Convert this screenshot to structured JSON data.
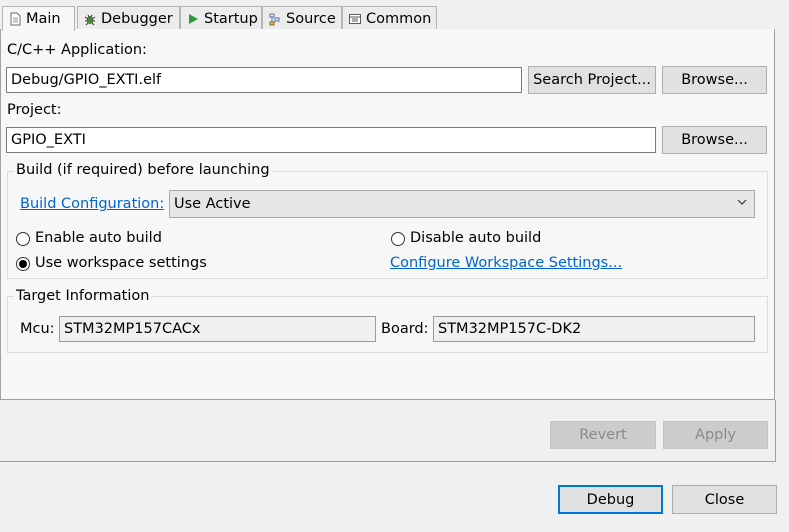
{
  "tabs": [
    {
      "label": "Main",
      "icon": "document-icon"
    },
    {
      "label": "Debugger",
      "icon": "bug-icon"
    },
    {
      "label": "Startup",
      "icon": "play-icon"
    },
    {
      "label": "Source",
      "icon": "source-icon"
    },
    {
      "label": "Common",
      "icon": "window-icon"
    }
  ],
  "application": {
    "label": "C/C++ Application:",
    "value": "Debug/GPIO_EXTI.elf",
    "search_button": "Search Project...",
    "browse_button": "Browse..."
  },
  "project": {
    "label": "Project:",
    "value": "GPIO_EXTI",
    "browse_button": "Browse..."
  },
  "build": {
    "group_title": "Build (if required) before launching",
    "config_link": "Build Configuration:",
    "config_value": "Use Active",
    "enable_auto": "Enable auto build",
    "disable_auto": "Disable auto build",
    "use_workspace": "Use workspace settings",
    "workspace_link": "Configure Workspace Settings..."
  },
  "target": {
    "group_title": "Target Information",
    "mcu_label": "Mcu:",
    "mcu_value": "STM32MP157CACx",
    "board_label": "Board:",
    "board_value": "STM32MP157C-DK2"
  },
  "actions": {
    "revert": "Revert",
    "apply": "Apply",
    "debug": "Debug",
    "close": "Close"
  },
  "colors": {
    "link": "#0066cc",
    "default_button_border": "#0078d7"
  }
}
